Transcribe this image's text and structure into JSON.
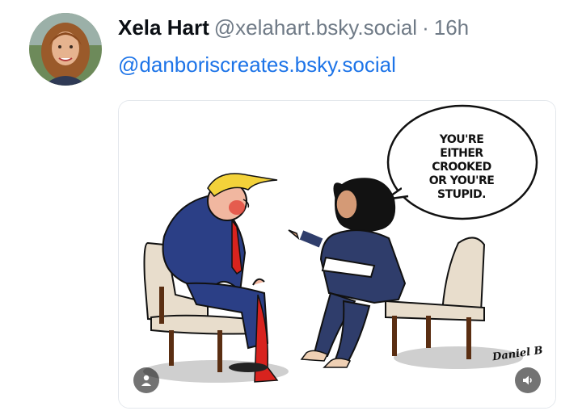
{
  "post": {
    "author": {
      "display_name": "Xela Hart",
      "handle": "@xelahart.bsky.social",
      "avatar_icon": "avatar-photo"
    },
    "separator": "·",
    "timestamp": "16h",
    "mention": "@danboriscreates.bsky.social"
  },
  "image": {
    "speech_bubble": "YOU'RE EITHER\nCROOKED\nOR YOU'RE\nSTUPID.",
    "signature": "Daniel B",
    "overlay_icons": [
      "person-icon",
      "sound-icon"
    ]
  },
  "colors": {
    "mention_link": "#1d74e8",
    "muted_text": "#6f7a86",
    "suit_blue": "#2b3f86",
    "tie_red": "#d8231e",
    "hair_yellow": "#f3d23a",
    "chair_beige": "#e8ddcc"
  }
}
